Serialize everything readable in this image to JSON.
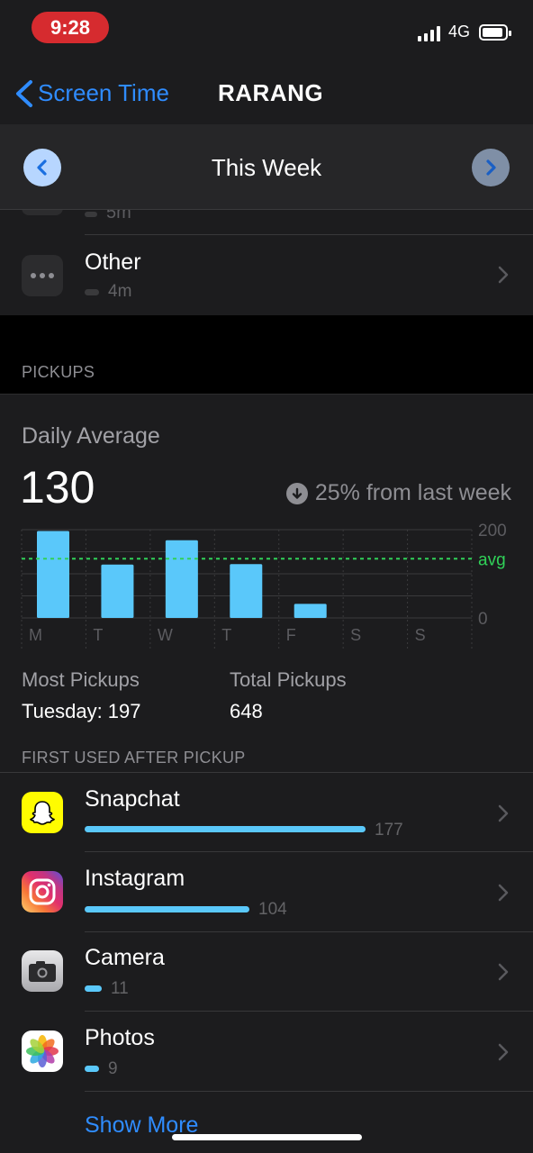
{
  "status_bar": {
    "time": "9:28",
    "network": "4G"
  },
  "nav": {
    "back_label": "Screen Time",
    "title": "RARANG"
  },
  "week_picker": {
    "label": "This Week"
  },
  "category_list": {
    "partial_item_value": "5m",
    "items": [
      {
        "name": "Other",
        "time": "4m"
      }
    ]
  },
  "pickups": {
    "section_label": "PICKUPS",
    "daily_average_label": "Daily Average",
    "daily_average_value": "130",
    "change_text": "25% from last week",
    "most_pickups_label": "Most Pickups",
    "most_pickups_value": "Tuesday: 197",
    "total_pickups_label": "Total Pickups",
    "total_pickups_value": "648"
  },
  "chart_data": {
    "type": "bar",
    "categories": [
      "M",
      "T",
      "W",
      "T",
      "F",
      "S",
      "S"
    ],
    "values": [
      197,
      121,
      176,
      122,
      32,
      0,
      0
    ],
    "y_tick_labels": [
      "200",
      "0"
    ],
    "average_label": "avg",
    "average_value": 130,
    "ylim": [
      0,
      200
    ],
    "bar_color": "#5ac8fa",
    "average_color": "#30d158",
    "grid": true
  },
  "first_used": {
    "section_label": "FIRST USED AFTER PICKUP",
    "max_count": 177,
    "apps": [
      {
        "name": "Snapchat",
        "count": "177",
        "icon": "snapchat-icon"
      },
      {
        "name": "Instagram",
        "count": "104",
        "icon": "instagram-icon"
      },
      {
        "name": "Camera",
        "count": "11",
        "icon": "camera-icon"
      },
      {
        "name": "Photos",
        "count": "9",
        "icon": "photos-icon"
      }
    ],
    "show_more_label": "Show More"
  },
  "colors": {
    "accent": "#2f8cff",
    "bar": "#5ac8fa",
    "status_pill": "#d62b2f",
    "card_bg": "#1c1c1e"
  }
}
